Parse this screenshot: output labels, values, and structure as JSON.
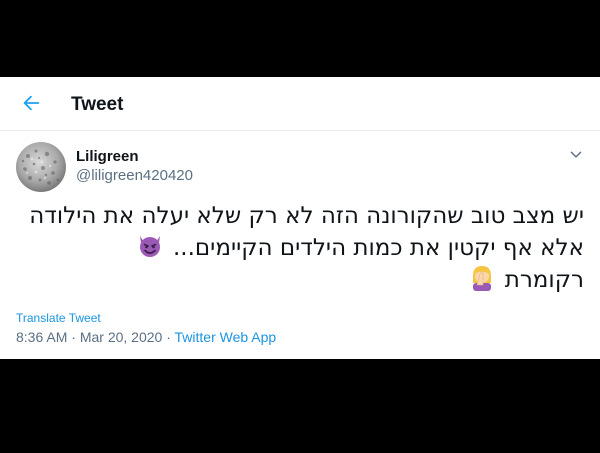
{
  "header": {
    "title": "Tweet",
    "back_icon": "arrow-left-icon",
    "accent_color": "#1da1f2"
  },
  "tweet": {
    "author_name": "Liligreen",
    "author_handle": "@liligreen420420",
    "more_icon": "chevron-down-icon",
    "text_lines": [
      "יש מצב טוב שהקורונה הזה לא רק שלא יעלה את הילודה",
      "אלא אף יקטין את כמות הילדים הקיימים...",
      "רקומרת"
    ],
    "emoji_line2": "smiling-face-with-horns",
    "emoji_line3": "woman-facepalming",
    "translate_label": "Translate Tweet",
    "time": "8:36 AM",
    "separator": "·",
    "date": "Mar 20, 2020",
    "source_app": "Twitter Web App"
  }
}
